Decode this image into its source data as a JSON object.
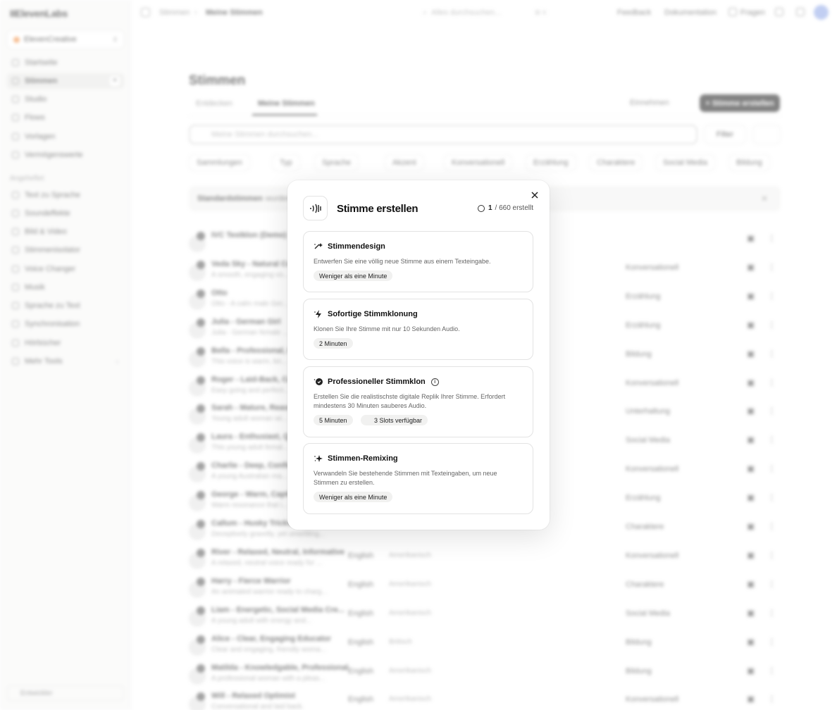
{
  "app": {
    "logo": "IIElevenLabs",
    "workspace": "ElevenCreative"
  },
  "sidebar": {
    "items": [
      {
        "label": "Startseite"
      },
      {
        "label": "Stimmen"
      },
      {
        "label": "Studio"
      },
      {
        "label": "Flows"
      },
      {
        "label": "Vorlagen"
      },
      {
        "label": "Vermögenswerte"
      }
    ],
    "section_label": "Angeheftet",
    "pinned": [
      {
        "label": "Text zu Sprache"
      },
      {
        "label": "Soundeffekte"
      },
      {
        "label": "Bild & Video"
      },
      {
        "label": "Stimmenisolator"
      },
      {
        "label": "Voice Changer"
      },
      {
        "label": "Musik"
      },
      {
        "label": "Sprache zu Text"
      },
      {
        "label": "Synchronisation"
      },
      {
        "label": "Hörbücher"
      },
      {
        "label": "Mehr Tools"
      }
    ],
    "upgrade_label": "Entwickler"
  },
  "topbar": {
    "breadcrumb": [
      "Stimmen",
      "Meine Stimmen"
    ],
    "search_placeholder": "Alles durchsuchen...",
    "search_shortcut": "⌘ K",
    "links": [
      "Feedback",
      "Dokumentation",
      "Fragen"
    ]
  },
  "main": {
    "title": "Stimmen",
    "tabs": [
      {
        "label": "Entdecken"
      },
      {
        "label": "Meine Stimmen"
      }
    ],
    "import_label": "Einnehmen",
    "create_label": "Stimme erstellen",
    "search_placeholder": "Meine Stimmen durchsuchen...",
    "filter_label": "Filter",
    "chips": [
      "Sammlungen",
      "Typ",
      "Sprache",
      "Akzent",
      "Konversationell",
      "Erzählung",
      "Charaktere",
      "Social Media",
      "Bildung"
    ],
    "banner_bold": "Standardstimmen",
    "banner_text": "wurden",
    "voices": [
      {
        "name": "IVC Testklon (Demo)",
        "desc": "",
        "lang": "",
        "accent": "",
        "category": ""
      },
      {
        "name": "Veda Sky - Natural Co...",
        "desc": "A smooth, engaging vo...",
        "lang": "",
        "accent": "",
        "category": "Konversationell"
      },
      {
        "name": "Otto",
        "desc": "Otto - A calm male Ger...",
        "lang": "",
        "accent": "",
        "category": "Erzählung"
      },
      {
        "name": "Julia - German Girl",
        "desc": "Julia - German female ...",
        "lang": "",
        "accent": "",
        "category": "Erzählung"
      },
      {
        "name": "Bella - Professional, Br...",
        "desc": "This voice is warm, bri...",
        "lang": "",
        "accent": "",
        "category": "Bildung"
      },
      {
        "name": "Roger - Laid-Back, Ca...",
        "desc": "Easy going and perfect...",
        "lang": "",
        "accent": "",
        "category": "Konversationell"
      },
      {
        "name": "Sarah - Mature, Reass...",
        "desc": "Young adult woman wi...",
        "lang": "",
        "accent": "",
        "category": "Unterhaltung"
      },
      {
        "name": "Laura - Enthusiast, Qu...",
        "desc": "This young adult femal...",
        "lang": "",
        "accent": "",
        "category": "Social Media"
      },
      {
        "name": "Charlie - Deep, Confid...",
        "desc": "A young Australian ma...",
        "lang": "",
        "accent": "",
        "category": "Konversationell"
      },
      {
        "name": "George - Warm, Capti...",
        "desc": "Warm resonance that i...",
        "lang": "",
        "accent": "",
        "category": "Erzählung"
      },
      {
        "name": "Callum - Husky Trickster",
        "desc": "Deceptively gravelly, yet unsettling...",
        "lang": "",
        "accent": "",
        "category": "Charaktere"
      },
      {
        "name": "River - Relaxed, Neutral, Informative",
        "desc": "A relaxed, neutral voice ready for ...",
        "lang": "English",
        "accent": "Amerikanisch",
        "category": "Konversationell"
      },
      {
        "name": "Harry - Fierce Warrior",
        "desc": "An animated warrior ready to charg...",
        "lang": "English",
        "accent": "Amerikanisch",
        "category": "Charaktere"
      },
      {
        "name": "Liam - Energetic, Social Media Cre...",
        "desc": "A young adult with energy and...",
        "lang": "English",
        "accent": "Amerikanisch",
        "category": "Social Media"
      },
      {
        "name": "Alice - Clear, Engaging Educator",
        "desc": "Clear and engaging, friendly woma...",
        "lang": "English",
        "accent": "Britisch",
        "category": "Bildung"
      },
      {
        "name": "Matilda - Knowledgable, Professional",
        "desc": "A professional woman with a pleas...",
        "lang": "English",
        "accent": "Amerikanisch",
        "category": "Bildung"
      },
      {
        "name": "Will - Relaxed Optimist",
        "desc": "Conversational and laid back.",
        "lang": "English",
        "accent": "Amerikanisch",
        "category": "Konversationell"
      }
    ]
  },
  "modal": {
    "title": "Stimme erstellen",
    "count_used": "1",
    "count_total": "/ 660 erstellt",
    "cards": [
      {
        "title": "Stimmendesign",
        "icon": "sparkle-design-icon",
        "description": "Entwerfen Sie eine völlig neue Stimme aus einem Texteingabe.",
        "badges": [
          "Weniger als eine Minute"
        ]
      },
      {
        "title": "Sofortige Stimmklonung",
        "icon": "lightning-icon",
        "description": "Klonen Sie Ihre Stimme mit nur 10 Sekunden Audio.",
        "badges": [
          "2 Minuten"
        ]
      },
      {
        "title": "Professioneller Stimmklon",
        "icon": "badge-check-icon",
        "description": "Erstellen Sie die realistischste digitale Replik Ihrer Stimme. Erfordert mindestens 30 Minuten sauberes Audio.",
        "badges": [
          "5 Minuten",
          "3 Slots verfügbar"
        ]
      },
      {
        "title": "Stimmen-Remixing",
        "icon": "sparkles-icon",
        "description": "Verwandeln Sie bestehende Stimmen mit Texteingaben, um neue Stimmen zu erstellen.",
        "badges": [
          "Weniger als eine Minute"
        ]
      }
    ]
  }
}
